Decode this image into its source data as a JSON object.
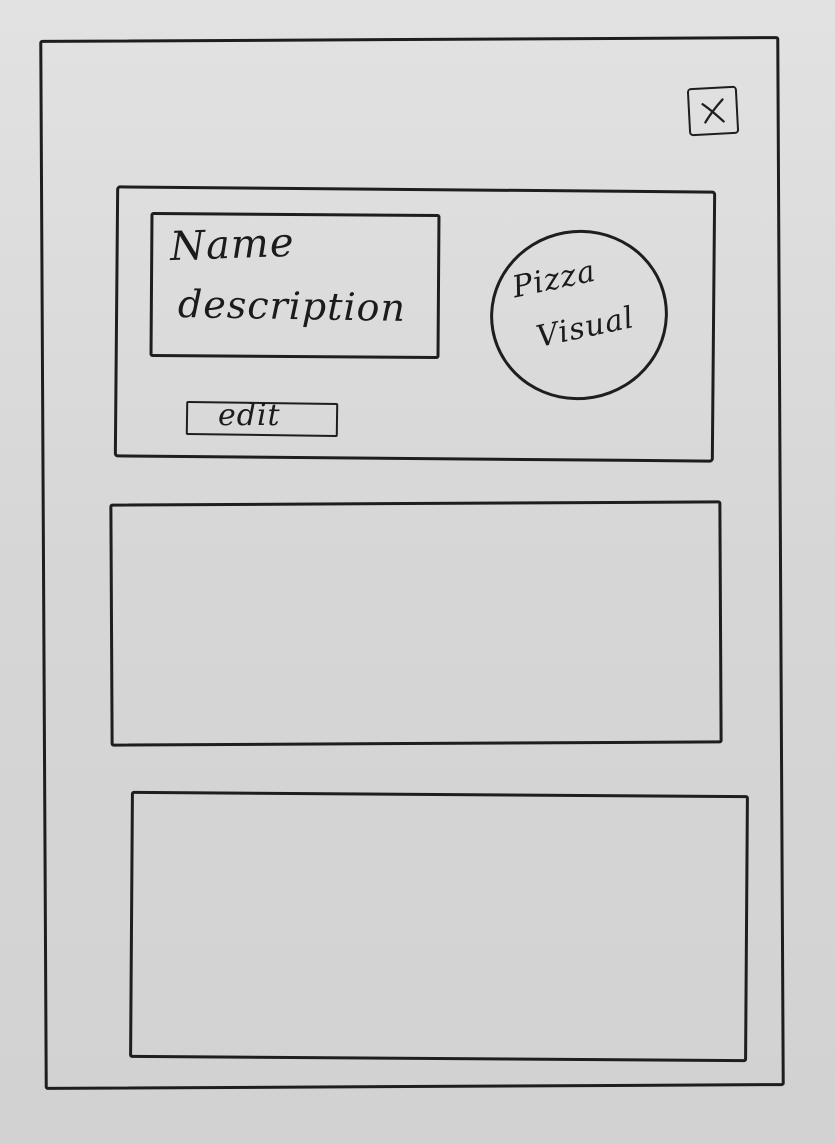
{
  "dialog": {
    "close_icon": "close-icon"
  },
  "pizza_card": {
    "name_label": "Name",
    "description_label": "description",
    "edit_label": "edit",
    "visual_line_1": "Pizza",
    "visual_line_2": "Visual"
  },
  "content_panels": [
    {
      "id": "panel-1"
    },
    {
      "id": "panel-2"
    }
  ]
}
